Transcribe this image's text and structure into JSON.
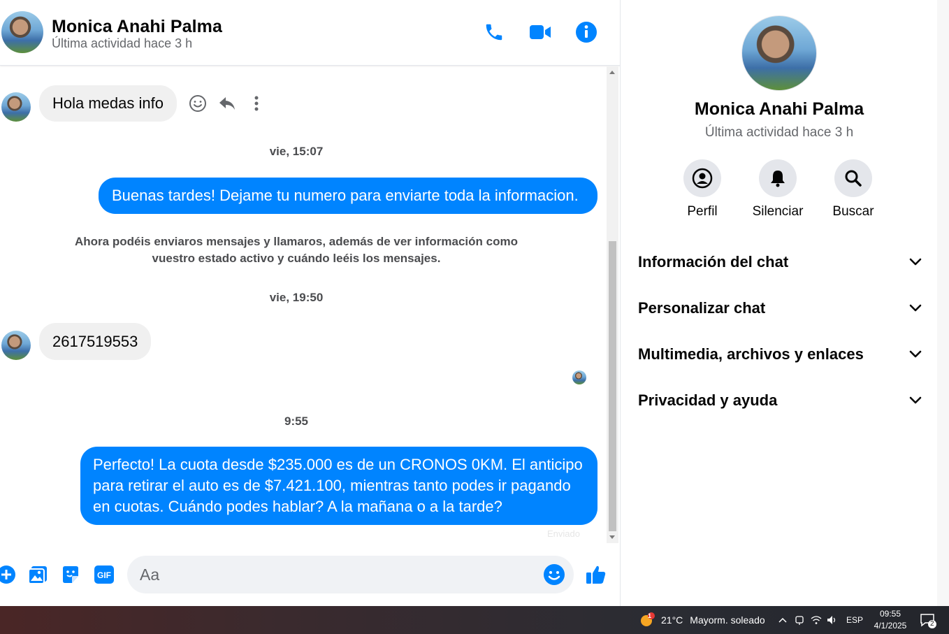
{
  "header": {
    "name": "Monica Anahi Palma",
    "status": "Última actividad hace 3 h",
    "icons": [
      "phone-icon",
      "video-icon",
      "info-icon"
    ]
  },
  "messages": {
    "first_incoming": "Hola medas info",
    "timestamp_1": "vie, 15:07",
    "outgoing_1": "Buenas tardes! Dejame tu numero para enviarte toda la informacion.",
    "notice": "Ahora podéis enviaros mensajes y llamaros, además de ver información como vuestro estado activo y cuándo leéis los mensajes.",
    "timestamp_2": "vie, 19:50",
    "incoming_2": "2617519553",
    "timestamp_3": "9:55",
    "outgoing_2": "Perfecto! La cuota desde $235.000 es de un CRONOS 0KM. El anticipo para retirar el auto es de $7.421.100, mientras tanto podes ir pagando en cuotas. Cuándo podes hablar? A la mañana o a la tarde?",
    "sent_label": "Enviado"
  },
  "composer": {
    "placeholder": "Aa",
    "icons": [
      "plus-icon",
      "photo-icon",
      "sticker-icon",
      "gif-icon",
      "emoji-icon",
      "thumbs-up-icon"
    ],
    "gif_label": "GIF"
  },
  "sidebar": {
    "name": "Monica Anahi Palma",
    "status": "Última actividad hace 3 h",
    "actions": [
      {
        "label": "Perfil",
        "icon": "profile-icon"
      },
      {
        "label": "Silenciar",
        "icon": "bell-icon"
      },
      {
        "label": "Buscar",
        "icon": "search-icon"
      }
    ],
    "sections": [
      {
        "label": "Información del chat"
      },
      {
        "label": "Personalizar chat"
      },
      {
        "label": "Multimedia, archivos y enlaces"
      },
      {
        "label": "Privacidad y ayuda"
      }
    ]
  },
  "taskbar": {
    "weather_temp": "21°C",
    "weather_desc": "Mayorm. soleado",
    "weather_badge": "1",
    "language": "ESP",
    "time": "09:55",
    "date": "4/1/2025",
    "notification_count": "2"
  },
  "colors": {
    "accent": "#0084ff",
    "bubble_in": "#f0f0f0",
    "text_secondary": "#65676b"
  }
}
